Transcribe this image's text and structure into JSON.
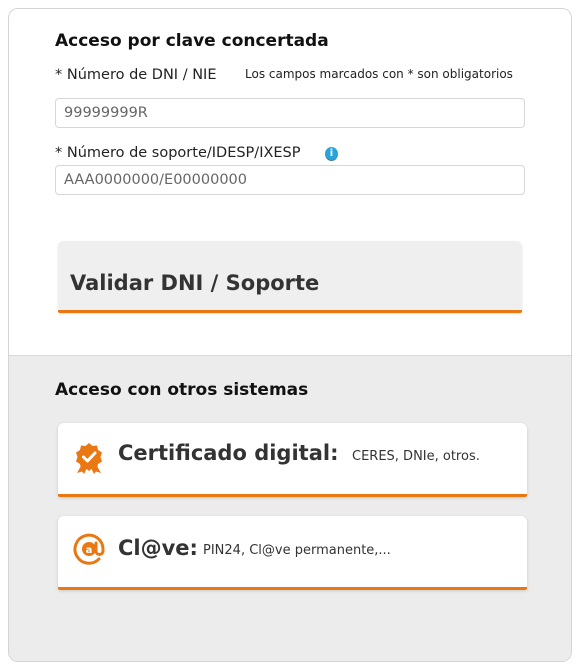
{
  "clave_concertada": {
    "title": "Acceso por clave concertada",
    "dni_label": "* Número de DNI / NIE",
    "required_note": "Los campos marcados con * son obligatorios",
    "dni_placeholder": "99999999R",
    "soporte_label": "* Número de soporte/IDESP/IXESP",
    "info_icon_glyph": "i",
    "soporte_placeholder": "AAA0000000/E00000000",
    "validate_button": "Validar DNI / Soporte"
  },
  "otros_sistemas": {
    "title": "Acceso con otros sistemas",
    "certificado": {
      "label": "Certificado digital:",
      "detail": "CERES, DNIe, otros.",
      "icon": "certificate-badge-icon"
    },
    "clave": {
      "label": "Cl@ve:",
      "detail": "PIN24, Cl@ve permanente,...",
      "icon": "clave-at-icon"
    }
  },
  "colors": {
    "accent": "#e97813",
    "info": "#29a3d9",
    "panel": "#ececec"
  }
}
